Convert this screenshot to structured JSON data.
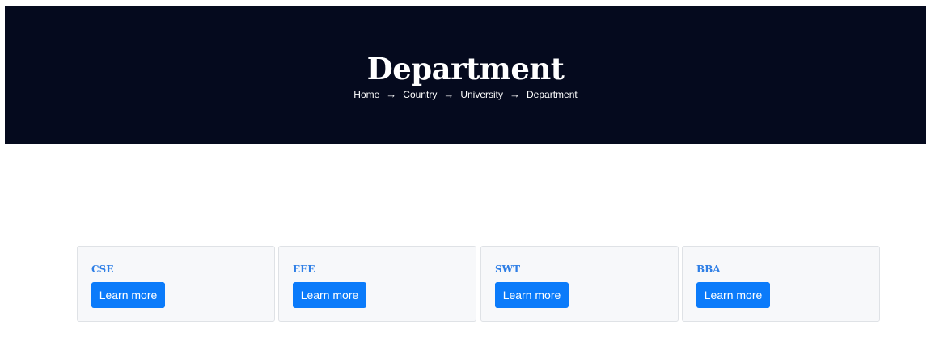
{
  "hero": {
    "title": "Department",
    "breadcrumb": {
      "items": [
        "Home",
        "Country",
        "University",
        "Department"
      ],
      "separator": "→"
    }
  },
  "departments": [
    {
      "name": "CSE",
      "button_label": "Learn more"
    },
    {
      "name": "EEE",
      "button_label": "Learn more"
    },
    {
      "name": "SWT",
      "button_label": "Learn more"
    },
    {
      "name": "BBA",
      "button_label": "Learn more"
    }
  ],
  "colors": {
    "hero_background": "#050a1e",
    "card_title": "#2f7fe6",
    "button": "#0b7bfa",
    "card_background": "#f7f8fa"
  }
}
